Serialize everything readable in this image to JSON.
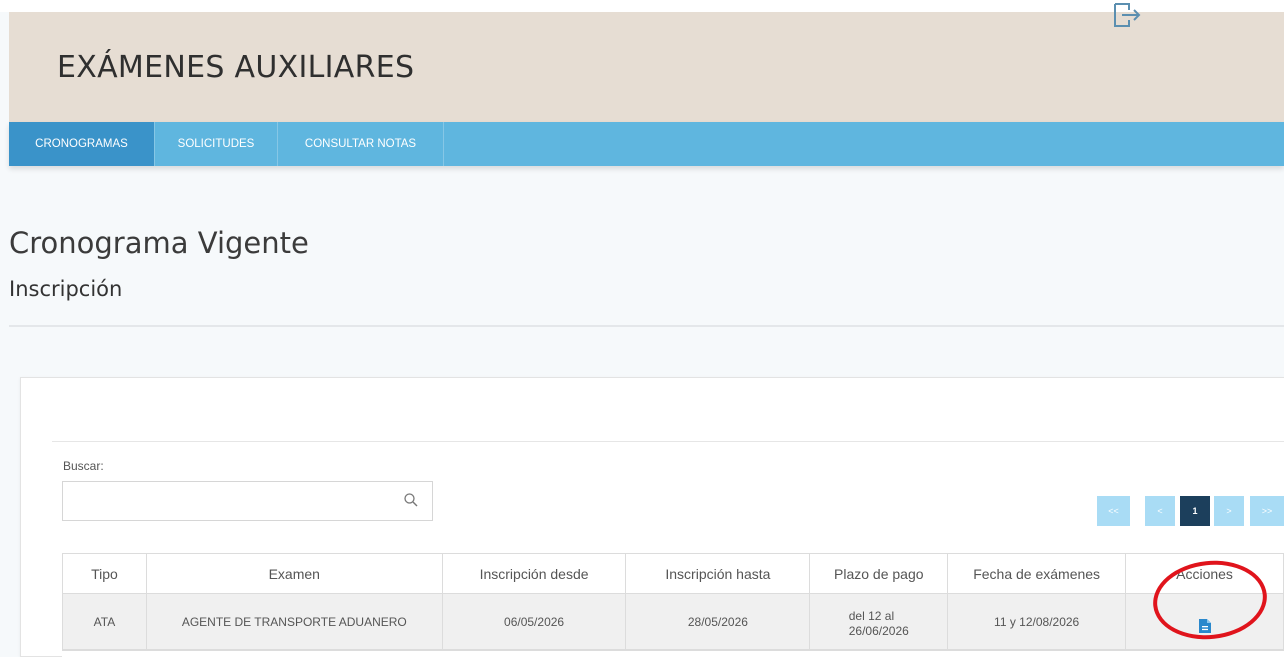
{
  "header": {
    "title": "EXÁMENES AUXILIARES"
  },
  "nav": {
    "tabs": [
      {
        "label": "CRONOGRAMAS",
        "active": true
      },
      {
        "label": "SOLICITUDES",
        "active": false
      },
      {
        "label": "CONSULTAR NOTAS",
        "active": false
      }
    ]
  },
  "page": {
    "title": "Cronograma Vigente",
    "subtitle": "Inscripción"
  },
  "search": {
    "label": "Buscar:",
    "value": "",
    "placeholder": ""
  },
  "pagination": {
    "first": "<<",
    "prev": "<",
    "current": "1",
    "next": ">",
    "last": ">>"
  },
  "table": {
    "headers": [
      "Tipo",
      "Examen",
      "Inscripción desde",
      "Inscripción hasta",
      "Plazo de pago",
      "Fecha de exámenes",
      "Acciones"
    ],
    "rows": [
      {
        "tipo": "ATA",
        "examen": "AGENTE DE TRANSPORTE ADUANERO",
        "desde": "06/05/2026",
        "hasta": "28/05/2026",
        "plazo_line1": "del 12 al",
        "plazo_line2": "26/06/2026",
        "fecha": "11 y 12/08/2026",
        "accion_icon": "document-icon"
      }
    ]
  },
  "colors": {
    "header_bg": "#e6ddd3",
    "nav_bg": "#5fb6df",
    "nav_active": "#3a93c9",
    "pager_bg": "#a9dcf5",
    "pager_current": "#1c3f5c",
    "action_icon": "#2a88cc",
    "highlight_circle": "#e0141c"
  }
}
